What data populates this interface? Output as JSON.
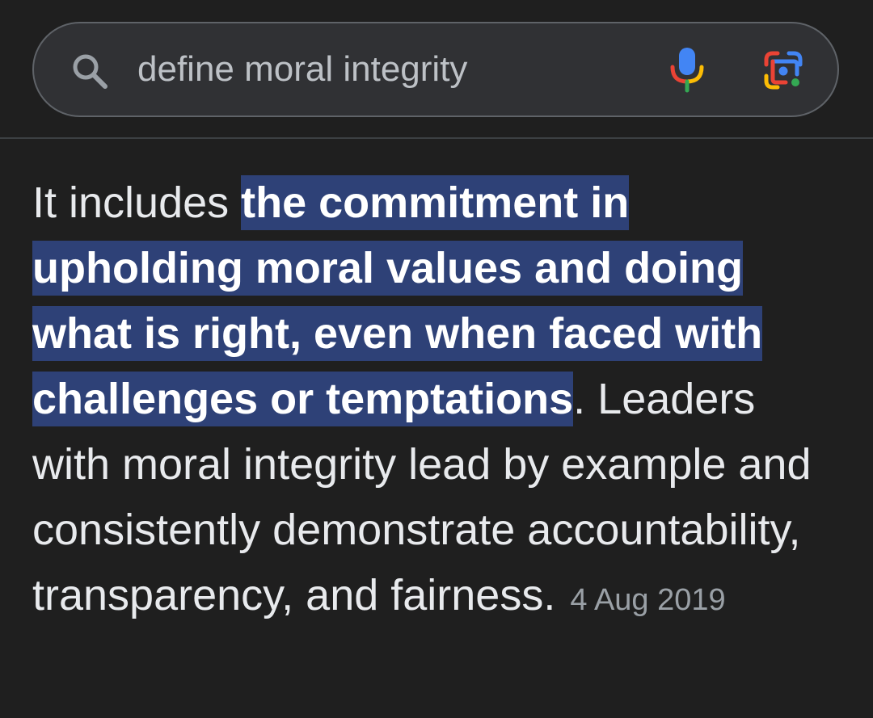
{
  "search": {
    "query": "define moral integrity",
    "icons": {
      "search": "search-icon",
      "voice": "mic-icon",
      "image_search": "lens-icon"
    }
  },
  "snippet": {
    "text_before": "It includes ",
    "highlighted": "the commitment in upholding moral values and doing what is right, even when faced with challenges or temptations",
    "text_after": ". Leaders with moral integrity lead by example and consistently demonstrate accountability, transparency, and fairness.",
    "date": "4 Aug 2019"
  },
  "colors": {
    "background": "#1f1f1f",
    "search_bar": "#303134",
    "highlight": "#2e4177",
    "text": "#e8eaed",
    "muted": "#9aa0a6"
  }
}
